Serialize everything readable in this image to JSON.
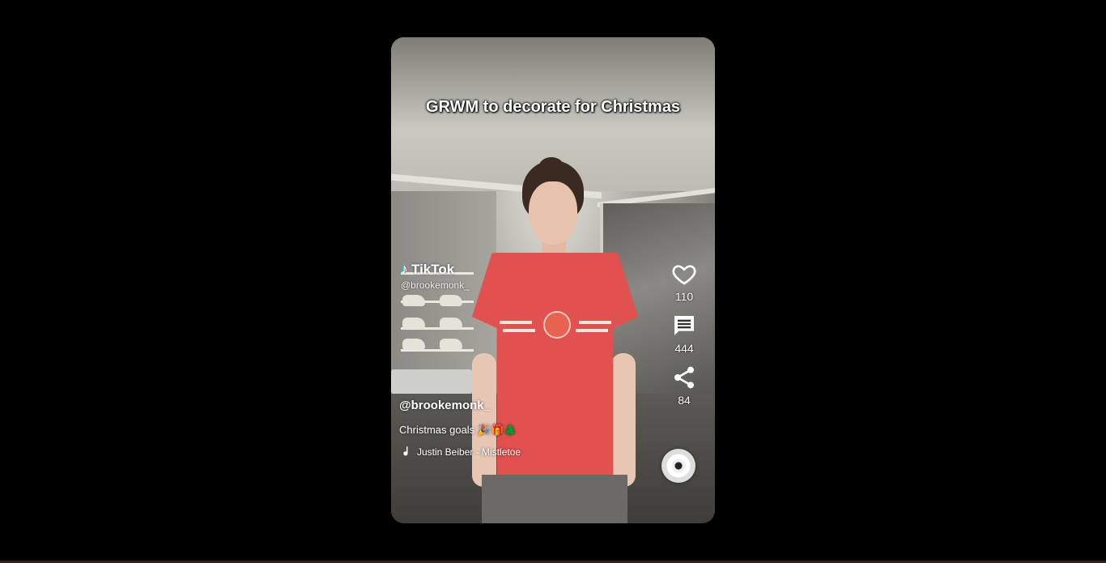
{
  "video": {
    "caption_overlay": "GRWM to decorate for Christmas",
    "watermark": {
      "brand": "TikTok",
      "handle": "@brookemonk_"
    }
  },
  "actions": {
    "likes": "110",
    "comments": "444",
    "shares": "84"
  },
  "meta": {
    "username": "@brookemonk_",
    "description": "Christmas goals 🎉🎁🌲",
    "music": "Justin Beiber - Mistletoe"
  },
  "colors": {
    "background": "#000000",
    "shirt": "#e0514f",
    "text": "#ffffff"
  },
  "icons": [
    "tiktok-logo-icon",
    "heart-icon",
    "comment-icon",
    "share-icon",
    "music-note-icon",
    "music-disc-icon"
  ]
}
